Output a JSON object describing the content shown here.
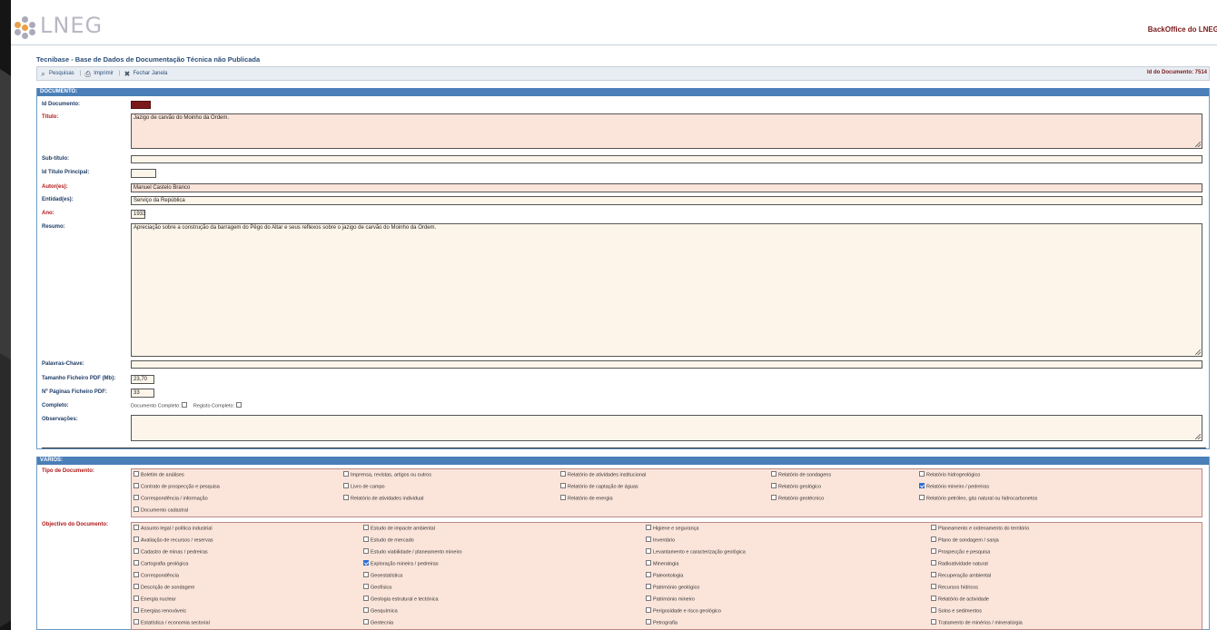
{
  "header": {
    "logo_text": "LNEG",
    "backoffice": "BackOffice do LNEG"
  },
  "app_title": "Tecnibase - Base de Dados de Documentação Técnica não Publicada",
  "toolbar": {
    "pesquisas": "Pesquisas",
    "imprimir": "Imprimir",
    "fechar": "Fechar Janela",
    "sep": "|",
    "doc_id": "Id do Documento: 7514"
  },
  "documento": {
    "heading": "DOCUMENTO:",
    "id_label": "Id Documento:",
    "id_value": "7514",
    "titulo_label": "Título:",
    "titulo_value": "Jazigo de carvão do Moinho da Ordem.",
    "subtitulo_label": "Sub-título:",
    "subtitulo_value": "",
    "idtitulo_label": "Id Título Principal:",
    "idtitulo_value": "",
    "autores_label": "Autor(es):",
    "autores_value": "Manuel Castelo Branco",
    "entidades_label": "Entidad(es):",
    "entidades_value": "Serviço da República",
    "ano_label": "Ano:",
    "ano_value": "1933",
    "resumo_label": "Resumo:",
    "resumo_value": "Apreciação sobre a construção da barragem do Pêgo do Altar e seus reflexos sobre o jazigo de carvão do Moinho da Ordem.",
    "palavras_label": "Palavras-Chave:",
    "palavras_value": "",
    "tamanho_label": "Tamanho Ficheiro PDF (Mb):",
    "tamanho_value": "23,70",
    "paginas_label": "Nº Páginas Ficheiro PDF:",
    "paginas_value": "33",
    "completo_label": "Completo:",
    "doc_completo": "Documento Completo:",
    "reg_completo": "Registo Completo:",
    "obs_label": "Observações:",
    "obs_value": ""
  },
  "varios": {
    "heading": "VÁRIOS:",
    "tipo_label": "Tipo de Documento:",
    "tipo_options": [
      {
        "label": "Boletim de análises",
        "checked": false
      },
      {
        "label": "Imprensa, revistas, artigos ou outros",
        "checked": false
      },
      {
        "label": "Relatório de atividades institucional",
        "checked": false
      },
      {
        "label": "Relatório de sondagens",
        "checked": false
      },
      {
        "label": "Relatório hidrogeológico",
        "checked": false
      },
      {
        "label": "Contrato de prospecção e pesquisa",
        "checked": false
      },
      {
        "label": "Livro de campo",
        "checked": false
      },
      {
        "label": "Relatório de captação de águas",
        "checked": false
      },
      {
        "label": "Relatório geológico",
        "checked": false
      },
      {
        "label": "Relatório mineiro / pedreiras",
        "checked": true
      },
      {
        "label": "Correspondência / informação",
        "checked": false
      },
      {
        "label": "Relatório de atividades individual",
        "checked": false
      },
      {
        "label": "Relatório de energia",
        "checked": false
      },
      {
        "label": "Relatório geotécnico",
        "checked": false
      },
      {
        "label": "Relatório petróleo, gás natural ou hidrocarbonetos",
        "checked": false
      },
      {
        "label": "Documento cadastral",
        "checked": false
      }
    ],
    "objectivo_label": "Objectivo do Documento:",
    "objectivo_options": [
      {
        "label": "Assunto legal / política industrial",
        "checked": false
      },
      {
        "label": "Estudo de impacte ambiental",
        "checked": false
      },
      {
        "label": "Higiene e segurança",
        "checked": false
      },
      {
        "label": "Planeamento e ordenamento do território",
        "checked": false
      },
      {
        "label": "Avaliação de recursos / reservas",
        "checked": false
      },
      {
        "label": "Estudo de mercado",
        "checked": false
      },
      {
        "label": "Inventário",
        "checked": false
      },
      {
        "label": "Plano de sondagem / sanja",
        "checked": false
      },
      {
        "label": "Cadastro de minas / pedreiras",
        "checked": false
      },
      {
        "label": "Estudo viabilidade / planeamento mineiro",
        "checked": false
      },
      {
        "label": "Levantamento e caracterização geológica",
        "checked": false
      },
      {
        "label": "Prospecção e pesquisa",
        "checked": false
      },
      {
        "label": "Cartografia geológica",
        "checked": false
      },
      {
        "label": "Exploração mineira / pedreiras",
        "checked": true
      },
      {
        "label": "Mineralogia",
        "checked": false
      },
      {
        "label": "Radioatividade natural",
        "checked": false
      },
      {
        "label": "Correspondência",
        "checked": false
      },
      {
        "label": "Geoestatística",
        "checked": false
      },
      {
        "label": "Paleontologia",
        "checked": false
      },
      {
        "label": "Recuperação ambiental",
        "checked": false
      },
      {
        "label": "Descrição de sondagem",
        "checked": false
      },
      {
        "label": "Geofísica",
        "checked": false
      },
      {
        "label": "Património geológico",
        "checked": false
      },
      {
        "label": "Recursos hídricos",
        "checked": false
      },
      {
        "label": "Energia nuclear",
        "checked": false
      },
      {
        "label": "Geologia estrutural e tectónica",
        "checked": false
      },
      {
        "label": "Património mineiro",
        "checked": false
      },
      {
        "label": "Relatório de actividade",
        "checked": false
      },
      {
        "label": "Energias renováveis",
        "checked": false
      },
      {
        "label": "Geoquímica",
        "checked": false
      },
      {
        "label": "Perigosidade e risco geológico",
        "checked": false
      },
      {
        "label": "Solos e sedimentos",
        "checked": false
      },
      {
        "label": "Estatística / economia sectorial",
        "checked": false
      },
      {
        "label": "Geotecnia",
        "checked": false
      },
      {
        "label": "Petrografia",
        "checked": false
      },
      {
        "label": "Tratamento de minérios / mineralúrgia",
        "checked": false
      }
    ]
  },
  "colors": {
    "section_header": "#4a7fb8",
    "required_label": "#b01818",
    "label": "#1e3c66",
    "id_badge": "#7a1a1a"
  }
}
